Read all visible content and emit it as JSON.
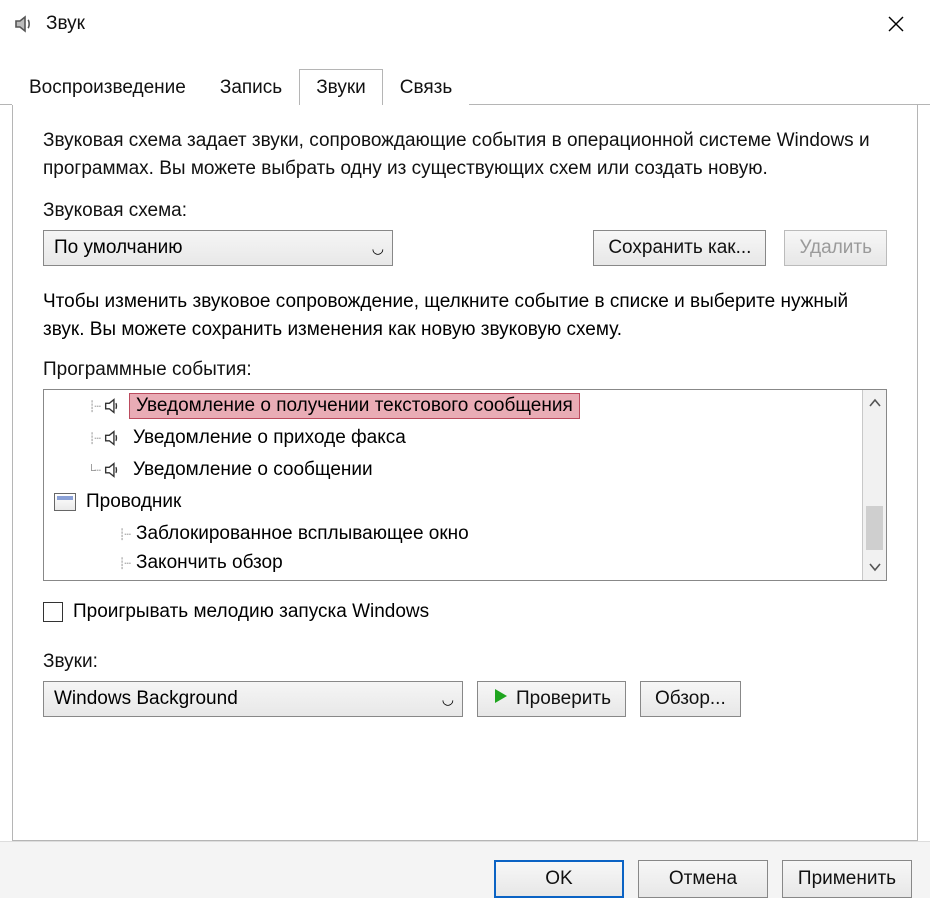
{
  "window": {
    "title": "Звук"
  },
  "tabs": [
    {
      "label": "Воспроизведение",
      "active": false
    },
    {
      "label": "Запись",
      "active": false
    },
    {
      "label": "Звуки",
      "active": true
    },
    {
      "label": "Связь",
      "active": false
    }
  ],
  "panel": {
    "description": "Звуковая схема задает звуки, сопровождающие события в операционной системе Windows и программах. Вы можете выбрать одну из существующих схем или создать новую.",
    "scheme_label": "Звуковая схема:",
    "scheme_value": "По умолчанию",
    "save_as": "Сохранить как...",
    "delete": "Удалить",
    "events_desc": "Чтобы изменить звуковое сопровождение, щелкните событие в списке и выберите нужный звук. Вы можете сохранить изменения как новую звуковую схему.",
    "events_label": "Программные события:",
    "events": [
      {
        "label": "Уведомление о получении текстового сообщения",
        "has_sound": true,
        "highlighted": true
      },
      {
        "label": "Уведомление о приходе факса",
        "has_sound": true,
        "highlighted": false
      },
      {
        "label": "Уведомление о сообщении",
        "has_sound": true,
        "highlighted": false
      }
    ],
    "group_label": "Проводник",
    "group_children": [
      {
        "label": "Заблокированное всплывающее окно"
      },
      {
        "label": "Закончить обзор"
      }
    ],
    "startup_checkbox": "Проигрывать мелодию запуска Windows",
    "sounds_label": "Звуки:",
    "sound_value": "Windows Background",
    "test": "Проверить",
    "browse": "Обзор..."
  },
  "footer": {
    "ok": "OK",
    "cancel": "Отмена",
    "apply": "Применить"
  }
}
